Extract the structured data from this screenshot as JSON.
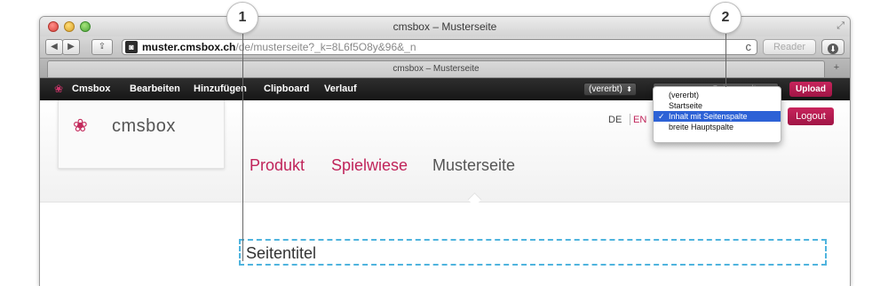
{
  "window": {
    "title": "cmsbox – Musterseite"
  },
  "toolbar": {
    "back_icon": "◀",
    "forward_icon": "▶",
    "share_icon": "⇪",
    "url_host": "muster.cmsbox.ch",
    "url_path": "/de/musterseite?_k=8L6f5O8y&96&_n",
    "reload_icon": "c",
    "reader_label": "Reader",
    "download_icon": "⬇"
  },
  "tab": {
    "title": "cmsbox – Musterseite",
    "new_tab_icon": "+"
  },
  "cms_bar": {
    "items": [
      "Cmsbox",
      "Bearbeiten",
      "Hinzufügen",
      "Clipboard",
      "Verlauf"
    ],
    "inherit_select": "(vererbt)",
    "layout_select": "Seitenspalte",
    "upload_label": "Upload"
  },
  "layout_dropdown": {
    "options": [
      "(vererbt)",
      "Startseite",
      "Inhalt mit Seitenspalte",
      "breite Hauptspalte"
    ],
    "selected": "Inhalt mit Seitenspalte"
  },
  "site": {
    "logo_text": "cmsbox",
    "languages": [
      "DE",
      "EN"
    ],
    "active_language": "EN",
    "logout_label": "Logout",
    "nav": [
      "Produkt",
      "Spielwiese",
      "Musterseite"
    ],
    "page_title": "Seitentitel"
  },
  "callouts": [
    "1",
    "2"
  ],
  "colors": {
    "brand": "#c0245a",
    "highlight": "#2d62d6",
    "dashed_border": "#4fb4de"
  }
}
